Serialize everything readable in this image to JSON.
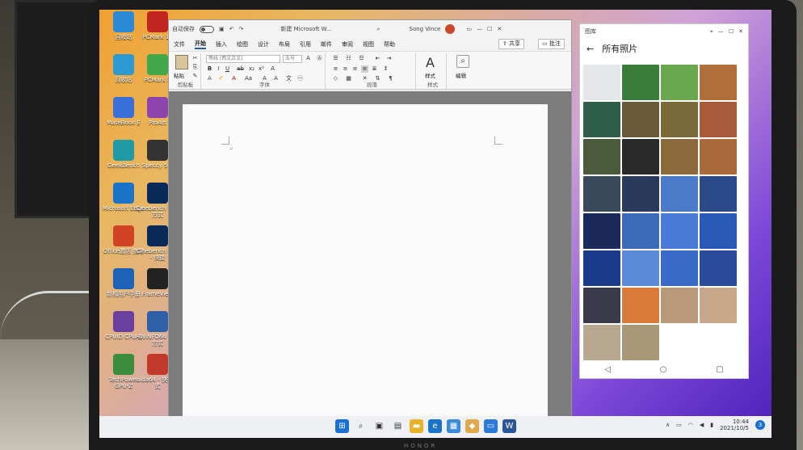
{
  "desktop_icons": [
    {
      "label": "回收站",
      "icon": "recycle-bin-icon",
      "color": "#2a8ad8"
    },
    {
      "label": "PCMark 10",
      "icon": "pcmark-icon",
      "color": "#c0261f"
    },
    {
      "label": "回收站",
      "icon": "recycle-icon",
      "color": "#2e9ad2"
    },
    {
      "label": "PCMark 8",
      "icon": "pcmark8-icon",
      "color": "#42a84a"
    },
    {
      "label": "MateBook E",
      "icon": "matebook-icon",
      "color": "#3a6fd8"
    },
    {
      "label": "ProArt",
      "icon": "proart-icon",
      "color": "#8e44ad"
    },
    {
      "label": "GeekBench",
      "icon": "geekbench-icon",
      "color": "#1f9aa6"
    },
    {
      "label": "Speccy 5.5",
      "icon": "speccy-icon",
      "color": "#333333"
    },
    {
      "label": "Microsoft Edge",
      "icon": "edge-icon",
      "color": "#1b73c8"
    },
    {
      "label": "Cinebench 快捷方式",
      "icon": "cinebench-icon",
      "color": "#0a2a5a"
    },
    {
      "label": "Office激活 指导",
      "icon": "office-icon",
      "color": "#d04423"
    },
    {
      "label": "Cinebench R23 - 快捷",
      "icon": "cinebench-r23-icon",
      "color": "#0a2a5a"
    },
    {
      "label": "新机用户手册",
      "icon": "manual-icon",
      "color": "#1c62b9"
    },
    {
      "label": "FrameView",
      "icon": "frameview-icon",
      "color": "#222222"
    },
    {
      "label": "CPUID CPU-Z",
      "icon": "cpuz-icon",
      "color": "#6a3fa0"
    },
    {
      "label": "HWiNFO64 快捷方式",
      "icon": "hwinfo-icon",
      "color": "#2f60a8"
    },
    {
      "label": "TechPower GPU-Z",
      "icon": "gpuz-icon",
      "color": "#3b8d3b"
    },
    {
      "label": "aida64 - 快捷方式",
      "icon": "aida64-icon",
      "color": "#c0392b"
    }
  ],
  "word": {
    "autosave_label": "自动保存",
    "doc_title": "新建 Microsoft W...",
    "user_name": "Song Vince",
    "share_label": "共享",
    "comment_label": "批注",
    "menu": [
      "文件",
      "开始",
      "插入",
      "绘图",
      "设计",
      "布局",
      "引用",
      "邮件",
      "审阅",
      "视图",
      "帮助"
    ],
    "active_menu_index": 1,
    "font_name": "等线 (西文正文)",
    "font_size": "五号",
    "groups": {
      "clipboard": "剪贴板",
      "paste": "粘贴",
      "font": "字体",
      "paragraph": "段落",
      "styles_group": "样式",
      "styles": "样式",
      "editing": "编辑"
    }
  },
  "gallery": {
    "app_title": "图库",
    "header": "所有照片",
    "photo_colors": [
      "#e5e7ea",
      "#3a7d3a",
      "#6aa84f",
      "#b06f3a",
      "#2f5f4a",
      "#6a5a3a",
      "#7a6a3a",
      "#a85a3a",
      "#4a5a3a",
      "#2a2a2a",
      "#8a6a3a",
      "#a86a3a",
      "#3a4a5a",
      "#2a3a5a",
      "#4a7ac8",
      "#2a4a8a",
      "#1a2a5a",
      "#3a6ab8",
      "#4a7ad8",
      "#2a5ab8",
      "#1a3a8a",
      "#5a8ad8",
      "#3a6ac8",
      "#2a4a9a",
      "#3a3a4a",
      "#d87a3a",
      "#b89a7a",
      "#c8a88a",
      "#b8a890",
      "#a89878",
      "#ffffff",
      "#ffffff"
    ]
  },
  "taskbar": {
    "time": "10:44",
    "date": "2021/10/5",
    "brand": "HONOR"
  }
}
